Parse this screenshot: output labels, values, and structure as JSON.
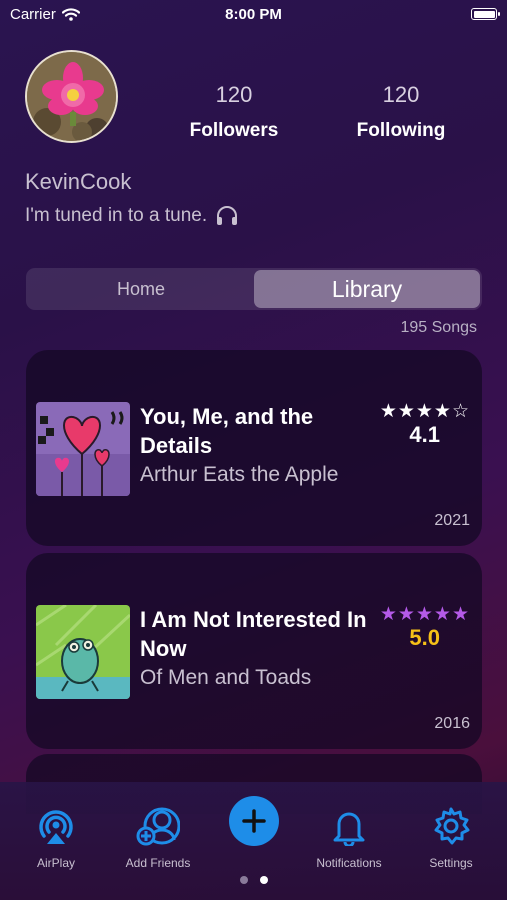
{
  "status_bar": {
    "carrier": "Carrier",
    "time": "8:00 PM"
  },
  "profile": {
    "followers_count": "120",
    "followers_label": "Followers",
    "following_count": "120",
    "following_label": "Following",
    "username": "KevinCook",
    "bio": "I'm tuned in to a tune."
  },
  "segments": {
    "home": "Home",
    "library": "Library",
    "selected": "Library"
  },
  "song_count": "195 Songs",
  "songs": [
    {
      "title": "You, Me, and the Details",
      "artist": "Arthur Eats the Apple",
      "stars": "★★★★☆",
      "rating": "4.1",
      "year": "2021"
    },
    {
      "title": "I Am Not Interested In Now",
      "artist": "Of Men and Toads",
      "stars": "★★★★★",
      "rating": "5.0",
      "year": "2016"
    }
  ],
  "tabbar": {
    "airplay": "AirPlay",
    "add_friends": "Add Friends",
    "notifications": "Notifications",
    "settings": "Settings"
  },
  "page_dots": {
    "count": 2,
    "active": 2
  },
  "colors": {
    "accent": "#1e8de8",
    "gold": "#f5c018",
    "purple_star": "#b45ae8"
  }
}
